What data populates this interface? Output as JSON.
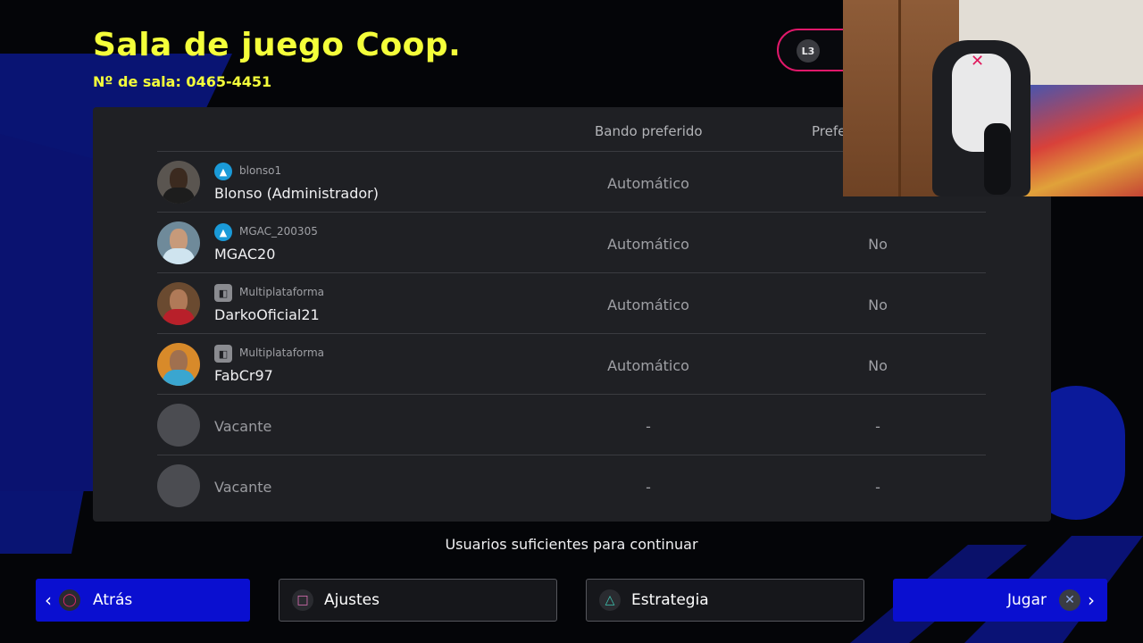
{
  "header": {
    "title": "Sala de juego Coop.",
    "room_label": "Nº de sala: 0465-4451",
    "l3_badge": "L3"
  },
  "table": {
    "col_side": "Bando preferido",
    "col_pref": "Prefe",
    "rows": [
      {
        "platform": "playstation",
        "subname": "blonso1",
        "name": "Blonso (Administrador)",
        "side": "Automático",
        "pref": ""
      },
      {
        "platform": "playstation",
        "subname": "MGAC_200305",
        "name": "MGAC20",
        "side": "Automático",
        "pref": "No"
      },
      {
        "platform": "multiplatform",
        "subname": "Multiplataforma",
        "name": "DarkoOficial21",
        "side": "Automático",
        "pref": "No"
      },
      {
        "platform": "multiplatform",
        "subname": "Multiplataforma",
        "name": "FabCr97",
        "side": "Automático",
        "pref": "No"
      },
      {
        "platform": "",
        "subname": "",
        "name": "Vacante",
        "side": "-",
        "pref": "-"
      },
      {
        "platform": "",
        "subname": "",
        "name": "Vacante",
        "side": "-",
        "pref": "-"
      }
    ]
  },
  "status_message": "Usuarios suficientes para continuar",
  "buttons": {
    "back": "Atrás",
    "settings": "Ajustes",
    "strategy": "Estrategia",
    "play": "Jugar"
  },
  "icons": {
    "playstation": "playstation-icon",
    "multiplatform": "gamepad-icon",
    "circle": "circle-button-icon",
    "square": "square-button-icon",
    "triangle": "triangle-button-icon",
    "cross": "cross-button-icon"
  },
  "colors": {
    "title": "#f4ff3a",
    "primary_button": "#0a0fd0",
    "panel": "#1f2024",
    "l3_border": "#e0186a"
  }
}
